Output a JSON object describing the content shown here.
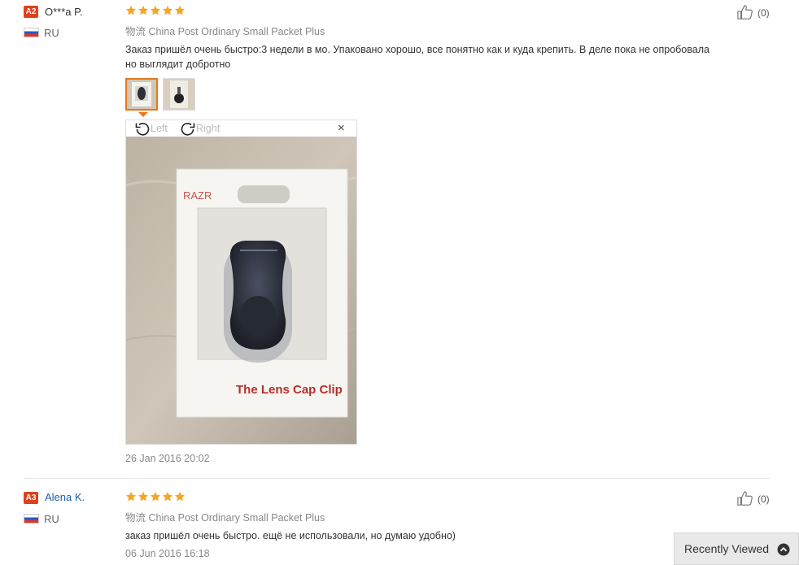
{
  "reviews": [
    {
      "level": "A2",
      "name": "O***a P.",
      "country": "RU",
      "stars": 5,
      "like_count": "(0)",
      "logistics_label": "物流",
      "logistics": "China Post Ordinary Small Packet Plus",
      "comment_line1": "Заказ пришёл очень быстро:3 недели в мо. Упаковано хорошо, все понятно как и куда крепить. В деле пока не опробовала",
      "comment_line2": "но выглядит добротно",
      "photo_count": 2,
      "viewer": {
        "rotate_left": "Left",
        "rotate_right": "Right",
        "close": "×",
        "package_brand": "RAZR",
        "package_title": "The Lens Cap Clip"
      },
      "date": "26 Jan 2016 20:02"
    },
    {
      "level": "A3",
      "name": "Alena K.",
      "country": "RU",
      "stars": 5,
      "like_count": "(0)",
      "logistics_label": "物流",
      "logistics": "China Post Ordinary Small Packet Plus",
      "comment_line1": "заказ пришёл очень быстро. ещё не использовали, но думаю удобно)",
      "date": "06 Jun 2016 16:18"
    }
  ],
  "recently_viewed": {
    "label": "Recently Viewed",
    "icon": "chevron-up-icon"
  },
  "colors": {
    "star": "#f5a623",
    "badge": "#e0401c",
    "link": "#1a5fa8",
    "active_thumb": "#e8771a"
  }
}
